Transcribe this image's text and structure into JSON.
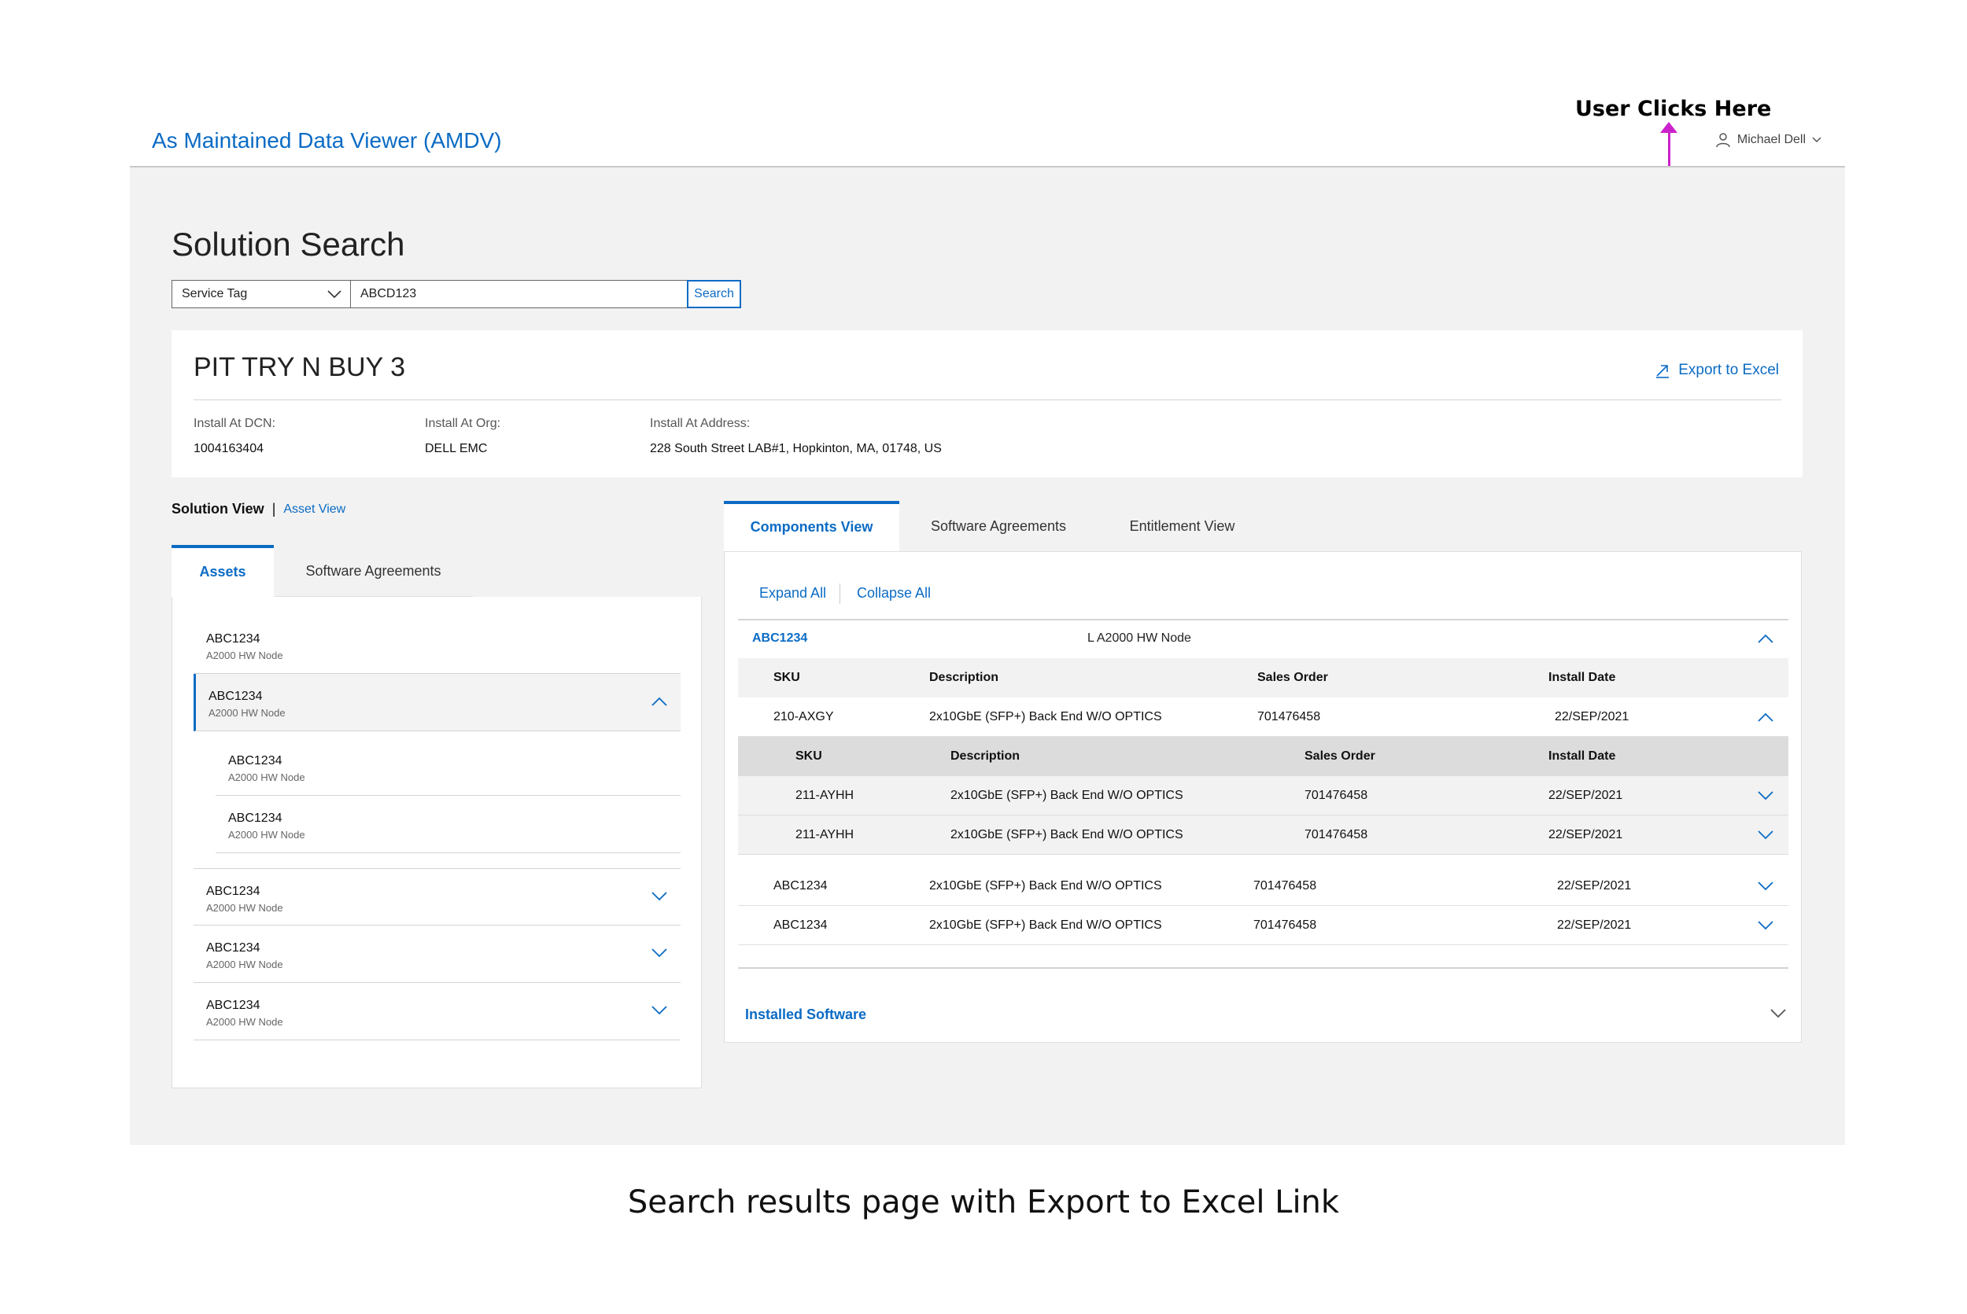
{
  "annotation": {
    "label": "User Clicks Here"
  },
  "header": {
    "app_title": "As Maintained Data Viewer (AMDV)",
    "user_name": "Michael Dell"
  },
  "page_title": "Solution Search",
  "search": {
    "type_value": "Service Tag",
    "query_value": "ABCD123",
    "button_label": "Search"
  },
  "info": {
    "title": "PIT TRY N BUY 3",
    "export_label": "Export to Excel",
    "fields": [
      {
        "label": "Install At DCN:",
        "value": "1004163404"
      },
      {
        "label": "Install At Org:",
        "value": "DELL EMC"
      },
      {
        "label": "Install At Address:",
        "value": "228 South Street LAB#1, Hopkinton, MA, 01748, US"
      }
    ]
  },
  "view_toggle": {
    "active": "Solution View",
    "separator": "|",
    "link": "Asset View"
  },
  "left_tabs": [
    "Assets",
    "Software Agreements"
  ],
  "assets": [
    {
      "name": "ABC1234",
      "sub": "A2000 HW Node"
    },
    {
      "name": "ABC1234",
      "sub": "A2000 HW Node"
    },
    {
      "name": "ABC1234",
      "sub": "A2000 HW Node"
    },
    {
      "name": "ABC1234",
      "sub": "A2000 HW Node"
    },
    {
      "name": "ABC1234",
      "sub": "A2000 HW Node"
    },
    {
      "name": "ABC1234",
      "sub": "A2000 HW Node"
    },
    {
      "name": "ABC1234",
      "sub": "A2000 HW Node"
    }
  ],
  "right_tabs": [
    "Components View",
    "Software Agreements",
    "Entitlement View"
  ],
  "components": {
    "expand_all": "Expand All",
    "collapse_all": "Collapse All",
    "group": {
      "id": "ABC1234",
      "desc": "L A2000 HW Node"
    },
    "columns": [
      "SKU",
      "Description",
      "Sales Order",
      "Install Date"
    ],
    "rows": [
      {
        "sku": "210-AXGY",
        "desc": "2x10GbE (SFP+) Back End W/O OPTICS",
        "order": "701476458",
        "date": "22/SEP/2021"
      },
      {
        "sku": "ABC1234",
        "desc": "2x10GbE (SFP+) Back End W/O OPTICS",
        "order": "701476458",
        "date": "22/SEP/2021"
      },
      {
        "sku": "ABC1234",
        "desc": "2x10GbE (SFP+) Back End W/O OPTICS",
        "order": "701476458",
        "date": "22/SEP/2021"
      }
    ],
    "sub_columns": [
      "SKU",
      "Description",
      "Sales Order",
      "Install Date"
    ],
    "sub_rows": [
      {
        "sku": "211-AYHH",
        "desc": "2x10GbE (SFP+) Back End W/O OPTICS",
        "order": "701476458",
        "date": "22/SEP/2021"
      },
      {
        "sku": "211-AYHH",
        "desc": "2x10GbE (SFP+) Back End W/O OPTICS",
        "order": "701476458",
        "date": "22/SEP/2021"
      }
    ],
    "installed_software": "Installed Software"
  },
  "caption": "Search results page with Export to Excel Link",
  "colors": {
    "accent": "#0b6bc4",
    "annotation": "#cc22cc",
    "canvas": "#f2f2f2"
  }
}
